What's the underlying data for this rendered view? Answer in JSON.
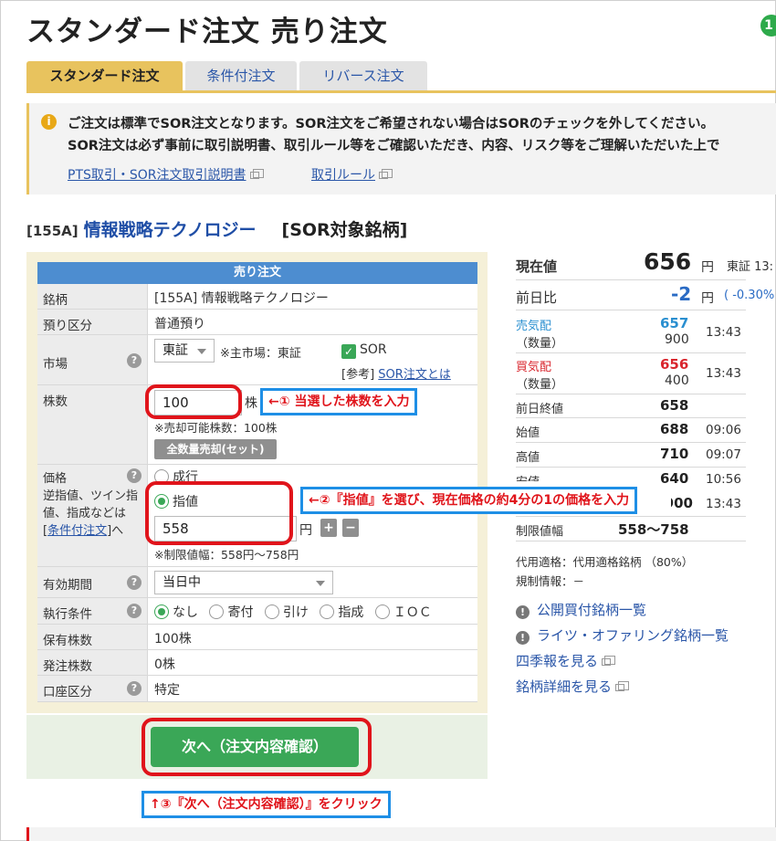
{
  "page": {
    "title": "スタンダード注文 売り注文",
    "corner_badge": "1"
  },
  "tabs": [
    {
      "label": "スタンダード注文",
      "active": true
    },
    {
      "label": "条件付注文",
      "active": false
    },
    {
      "label": "リバース注文",
      "active": false
    }
  ],
  "notice": {
    "icon": "info-icon",
    "line1": "ご注文は標準でSOR注文となります。SOR注文をご希望されない場合はSORのチェックを外してください。",
    "line2": "SOR注文は必ず事前に取引説明書、取引ルール等をご確認いただき、内容、リスク等をご理解いただいた上で",
    "link1": "PTS取引・SOR注文取引説明書",
    "link2": "取引ルール"
  },
  "stock": {
    "code": "[155A]",
    "name": "情報戦略テクノロジー",
    "sor_tag": "[SOR対象銘柄]"
  },
  "form": {
    "header": "売り注文",
    "rows": {
      "meigara": {
        "label": "銘柄",
        "value": "[155A] 情報戦略テクノロジー"
      },
      "azukari": {
        "label": "預り区分",
        "value": "普通預り"
      },
      "market": {
        "label": "市場",
        "select": "東証",
        "note": "※主市場：東証",
        "sor_label": "SOR",
        "sor_checked": true,
        "ref": "[参考]",
        "ref_link": "SOR注文とは"
      },
      "shares": {
        "label": "株数",
        "value": "100",
        "unit": "株",
        "available": "※売却可能株数：100株",
        "all_button": "全数量売却(セット)"
      },
      "price": {
        "label_lines": [
          "価格",
          "逆指値、ツイン指",
          "値、指成などは",
          "["
        ],
        "label_link": "条件付注文",
        "label_tail": "]へ",
        "option_market": "成行",
        "option_limit": "指値",
        "selected": "指値",
        "value": "558",
        "unit": "円",
        "plus": "+",
        "minus": "−",
        "limit_range": "※制限値幅：558円〜758円"
      },
      "period": {
        "label": "有効期間",
        "select": "当日中"
      },
      "condition": {
        "label": "執行条件",
        "options": [
          "なし",
          "寄付",
          "引け",
          "指成",
          "ＩＯＣ"
        ],
        "selected": "なし"
      },
      "holding": {
        "label": "保有株数",
        "value": "100株"
      },
      "ordered": {
        "label": "発注株数",
        "value": "0株"
      },
      "account": {
        "label": "口座区分",
        "value": "特定"
      }
    },
    "submit_label": "次へ（注文内容確認）"
  },
  "annotations": {
    "a1": "←① 当選した株数を入力",
    "a2": "←②『指値』を選び、現在価格の約4分の1の価格を入力",
    "a3": "↑③『次へ（注文内容確認）』をクリック"
  },
  "quote": {
    "current_label": "現在値",
    "current_value": "656",
    "current_unit": "円",
    "current_market": "東証 13:",
    "change_label": "前日比",
    "change_value": "-2",
    "change_unit": "円",
    "change_pct": "( -0.30%",
    "ask_label": "売気配",
    "ask_value": "657",
    "ask_qty_label": "（数量）",
    "ask_qty": "900",
    "ask_time": "13:43",
    "bid_label": "買気配",
    "bid_value": "656",
    "bid_qty_label": "（数量）",
    "bid_qty": "400",
    "bid_time": "13:43",
    "prev_close_label": "前日終値",
    "prev_close": "658",
    "open_label": "始値",
    "open": "688",
    "open_time": "09:06",
    "high_label": "高値",
    "high": "710",
    "high_time": "09:07",
    "low_label": "安値",
    "low": "640",
    "low_time": "10:56",
    "volume_value": "900",
    "volume_time": "13:43",
    "limit_label": "制限値幅",
    "limit": "558〜758",
    "collateral": "代用適格：代用適格銘柄 （80%）",
    "regulation": "規制情報：－",
    "links": {
      "public_offering": "公開買付銘柄一覧",
      "rights_offering": "ライツ・オファリング銘柄一覧",
      "shikiho": "四季報を見る",
      "detail": "銘柄詳細を見る"
    }
  },
  "colors": {
    "accent_yellow": "#e8c35e",
    "form_header_blue": "#4d8dd0",
    "submit_green": "#3aa757",
    "highlight_red": "#e0141b",
    "annotation_blue": "#1e8fe6"
  }
}
